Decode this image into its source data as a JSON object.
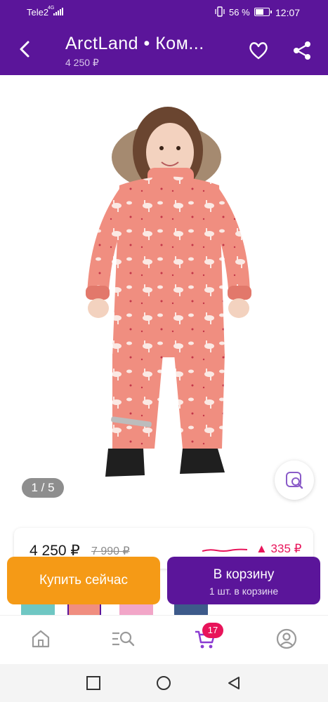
{
  "status_bar": {
    "carrier": "Tele2",
    "network": "4G",
    "battery_percent": "56 %",
    "battery_level": 0.56,
    "time": "12:07"
  },
  "header": {
    "title": "ArctLand  •  Ком...",
    "subtitle": "4 250 ₽",
    "icons": [
      "back-arrow-icon",
      "heart-icon",
      "share-icon"
    ]
  },
  "gallery": {
    "counter": "1 / 5",
    "image": "child-pink-winter-overall",
    "colors": {
      "suit": "#f08e80",
      "boots": "#1f1f1f",
      "fur": "#a58a70"
    }
  },
  "price": {
    "current": "4 250 ₽",
    "old": "7 990 ₽",
    "change": "▲ 335 ₽",
    "change_color": "#e8145a"
  },
  "actions": {
    "buy_now": "Купить сейчас",
    "add_to_cart": "В корзину",
    "in_cart": "1 шт. в корзине"
  },
  "bottom_nav": {
    "items": [
      "home-icon",
      "catalog-search-icon",
      "cart-icon",
      "profile-icon"
    ],
    "cart_badge": "17"
  },
  "system_nav": [
    "recents-icon",
    "home-circle-icon",
    "back-triangle-icon"
  ],
  "colors": {
    "brand": "#5b159a",
    "accent": "#f59a16",
    "badge": "#e8145a"
  }
}
